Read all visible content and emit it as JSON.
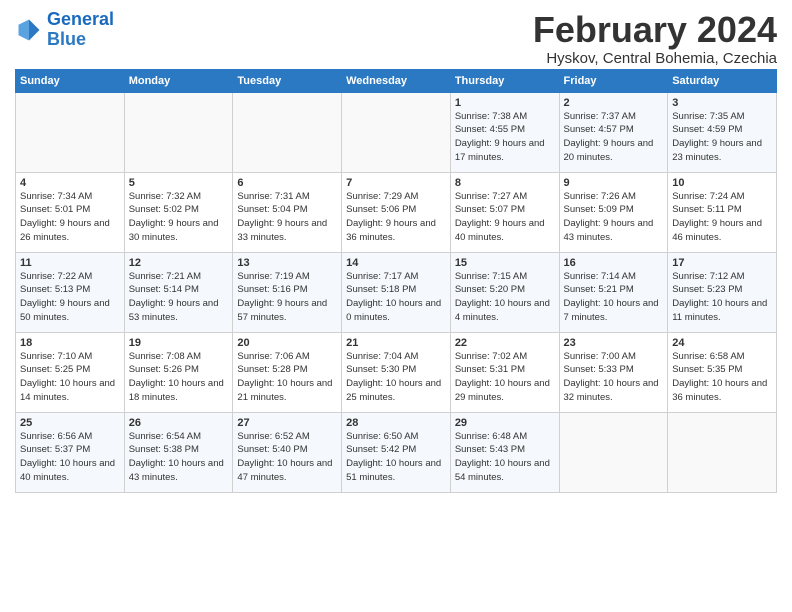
{
  "logo": {
    "text_general": "General",
    "text_blue": "Blue"
  },
  "header": {
    "month_year": "February 2024",
    "location": "Hyskov, Central Bohemia, Czechia"
  },
  "days_of_week": [
    "Sunday",
    "Monday",
    "Tuesday",
    "Wednesday",
    "Thursday",
    "Friday",
    "Saturday"
  ],
  "weeks": [
    [
      {
        "day": "",
        "sunrise": "",
        "sunset": "",
        "daylight": ""
      },
      {
        "day": "",
        "sunrise": "",
        "sunset": "",
        "daylight": ""
      },
      {
        "day": "",
        "sunrise": "",
        "sunset": "",
        "daylight": ""
      },
      {
        "day": "",
        "sunrise": "",
        "sunset": "",
        "daylight": ""
      },
      {
        "day": "1",
        "sunrise": "Sunrise: 7:38 AM",
        "sunset": "Sunset: 4:55 PM",
        "daylight": "Daylight: 9 hours and 17 minutes."
      },
      {
        "day": "2",
        "sunrise": "Sunrise: 7:37 AM",
        "sunset": "Sunset: 4:57 PM",
        "daylight": "Daylight: 9 hours and 20 minutes."
      },
      {
        "day": "3",
        "sunrise": "Sunrise: 7:35 AM",
        "sunset": "Sunset: 4:59 PM",
        "daylight": "Daylight: 9 hours and 23 minutes."
      }
    ],
    [
      {
        "day": "4",
        "sunrise": "Sunrise: 7:34 AM",
        "sunset": "Sunset: 5:01 PM",
        "daylight": "Daylight: 9 hours and 26 minutes."
      },
      {
        "day": "5",
        "sunrise": "Sunrise: 7:32 AM",
        "sunset": "Sunset: 5:02 PM",
        "daylight": "Daylight: 9 hours and 30 minutes."
      },
      {
        "day": "6",
        "sunrise": "Sunrise: 7:31 AM",
        "sunset": "Sunset: 5:04 PM",
        "daylight": "Daylight: 9 hours and 33 minutes."
      },
      {
        "day": "7",
        "sunrise": "Sunrise: 7:29 AM",
        "sunset": "Sunset: 5:06 PM",
        "daylight": "Daylight: 9 hours and 36 minutes."
      },
      {
        "day": "8",
        "sunrise": "Sunrise: 7:27 AM",
        "sunset": "Sunset: 5:07 PM",
        "daylight": "Daylight: 9 hours and 40 minutes."
      },
      {
        "day": "9",
        "sunrise": "Sunrise: 7:26 AM",
        "sunset": "Sunset: 5:09 PM",
        "daylight": "Daylight: 9 hours and 43 minutes."
      },
      {
        "day": "10",
        "sunrise": "Sunrise: 7:24 AM",
        "sunset": "Sunset: 5:11 PM",
        "daylight": "Daylight: 9 hours and 46 minutes."
      }
    ],
    [
      {
        "day": "11",
        "sunrise": "Sunrise: 7:22 AM",
        "sunset": "Sunset: 5:13 PM",
        "daylight": "Daylight: 9 hours and 50 minutes."
      },
      {
        "day": "12",
        "sunrise": "Sunrise: 7:21 AM",
        "sunset": "Sunset: 5:14 PM",
        "daylight": "Daylight: 9 hours and 53 minutes."
      },
      {
        "day": "13",
        "sunrise": "Sunrise: 7:19 AM",
        "sunset": "Sunset: 5:16 PM",
        "daylight": "Daylight: 9 hours and 57 minutes."
      },
      {
        "day": "14",
        "sunrise": "Sunrise: 7:17 AM",
        "sunset": "Sunset: 5:18 PM",
        "daylight": "Daylight: 10 hours and 0 minutes."
      },
      {
        "day": "15",
        "sunrise": "Sunrise: 7:15 AM",
        "sunset": "Sunset: 5:20 PM",
        "daylight": "Daylight: 10 hours and 4 minutes."
      },
      {
        "day": "16",
        "sunrise": "Sunrise: 7:14 AM",
        "sunset": "Sunset: 5:21 PM",
        "daylight": "Daylight: 10 hours and 7 minutes."
      },
      {
        "day": "17",
        "sunrise": "Sunrise: 7:12 AM",
        "sunset": "Sunset: 5:23 PM",
        "daylight": "Daylight: 10 hours and 11 minutes."
      }
    ],
    [
      {
        "day": "18",
        "sunrise": "Sunrise: 7:10 AM",
        "sunset": "Sunset: 5:25 PM",
        "daylight": "Daylight: 10 hours and 14 minutes."
      },
      {
        "day": "19",
        "sunrise": "Sunrise: 7:08 AM",
        "sunset": "Sunset: 5:26 PM",
        "daylight": "Daylight: 10 hours and 18 minutes."
      },
      {
        "day": "20",
        "sunrise": "Sunrise: 7:06 AM",
        "sunset": "Sunset: 5:28 PM",
        "daylight": "Daylight: 10 hours and 21 minutes."
      },
      {
        "day": "21",
        "sunrise": "Sunrise: 7:04 AM",
        "sunset": "Sunset: 5:30 PM",
        "daylight": "Daylight: 10 hours and 25 minutes."
      },
      {
        "day": "22",
        "sunrise": "Sunrise: 7:02 AM",
        "sunset": "Sunset: 5:31 PM",
        "daylight": "Daylight: 10 hours and 29 minutes."
      },
      {
        "day": "23",
        "sunrise": "Sunrise: 7:00 AM",
        "sunset": "Sunset: 5:33 PM",
        "daylight": "Daylight: 10 hours and 32 minutes."
      },
      {
        "day": "24",
        "sunrise": "Sunrise: 6:58 AM",
        "sunset": "Sunset: 5:35 PM",
        "daylight": "Daylight: 10 hours and 36 minutes."
      }
    ],
    [
      {
        "day": "25",
        "sunrise": "Sunrise: 6:56 AM",
        "sunset": "Sunset: 5:37 PM",
        "daylight": "Daylight: 10 hours and 40 minutes."
      },
      {
        "day": "26",
        "sunrise": "Sunrise: 6:54 AM",
        "sunset": "Sunset: 5:38 PM",
        "daylight": "Daylight: 10 hours and 43 minutes."
      },
      {
        "day": "27",
        "sunrise": "Sunrise: 6:52 AM",
        "sunset": "Sunset: 5:40 PM",
        "daylight": "Daylight: 10 hours and 47 minutes."
      },
      {
        "day": "28",
        "sunrise": "Sunrise: 6:50 AM",
        "sunset": "Sunset: 5:42 PM",
        "daylight": "Daylight: 10 hours and 51 minutes."
      },
      {
        "day": "29",
        "sunrise": "Sunrise: 6:48 AM",
        "sunset": "Sunset: 5:43 PM",
        "daylight": "Daylight: 10 hours and 54 minutes."
      },
      {
        "day": "",
        "sunrise": "",
        "sunset": "",
        "daylight": ""
      },
      {
        "day": "",
        "sunrise": "",
        "sunset": "",
        "daylight": ""
      }
    ]
  ]
}
